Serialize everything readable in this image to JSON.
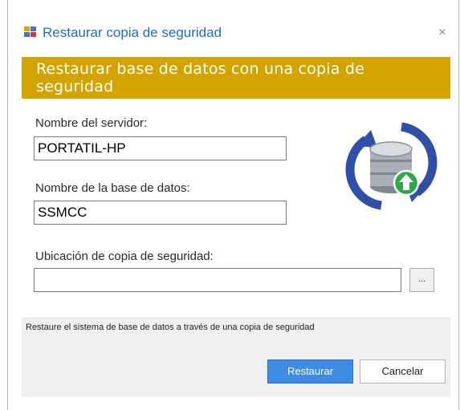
{
  "window": {
    "title": "Restaurar copia de seguridad",
    "close_glyph": "×",
    "app_icon": "database-restore-icon"
  },
  "banner": {
    "title": "Restaurar base de datos con una copia de seguridad",
    "color": "#d4a300"
  },
  "form": {
    "server_label": "Nombre del servidor:",
    "server_value": "PORTATIL-HP",
    "database_label": "Nombre de la base de datos:",
    "database_value": "SSMCC",
    "backup_label": "Ubicación de copia de seguridad:",
    "backup_value": "",
    "browse_label": "..."
  },
  "illustration": {
    "icon": "database-sync-icon"
  },
  "footer": {
    "status_text": "Restaure el sistema de base de datos a través de una copia de seguridad",
    "restore_label": "Restaurar",
    "cancel_label": "Cancelar",
    "accent_color": "#3e8be3"
  }
}
